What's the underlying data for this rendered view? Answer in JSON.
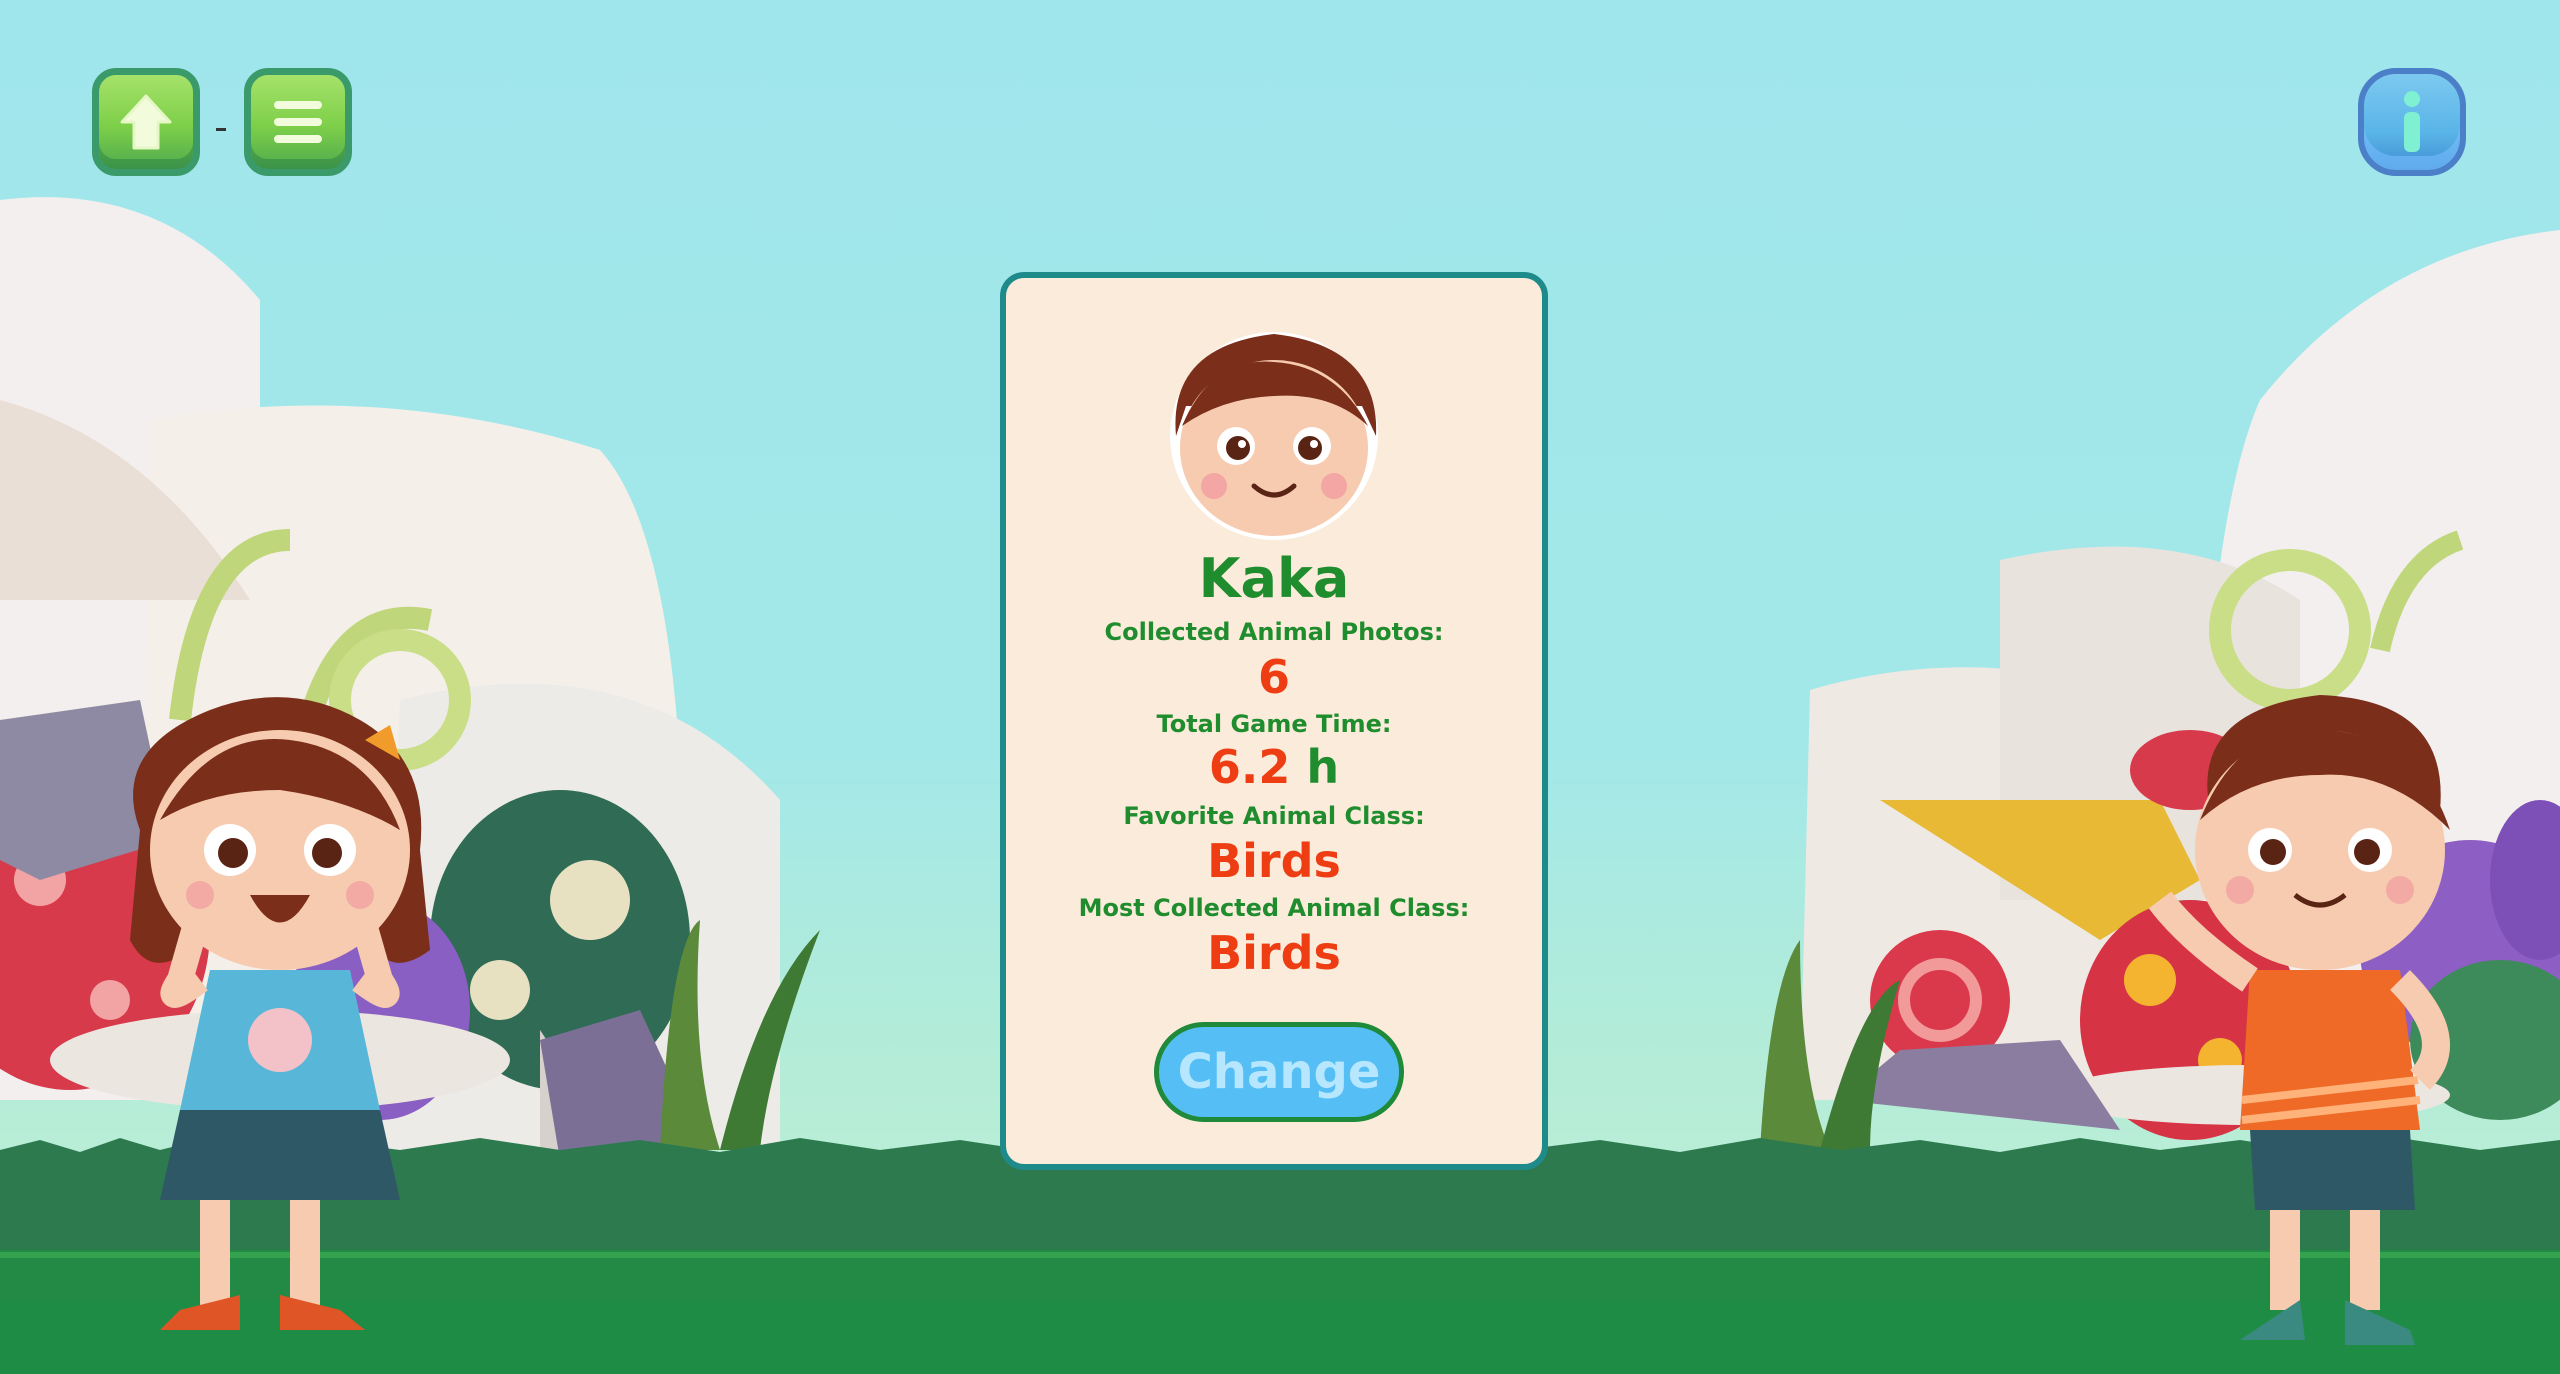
{
  "toolbar": {
    "home_icon": "home-icon",
    "menu_icon": "menu-icon",
    "info_icon": "info-icon"
  },
  "profile": {
    "name": "Kaka",
    "collected_label": "Collected Animal Photos:",
    "collected_value": "6",
    "time_label": "Total Game Time:",
    "time_value": "6.2",
    "time_unit": "h",
    "favorite_label": "Favorite Animal Class:",
    "favorite_value": "Birds",
    "most_label": "Most Collected Animal Class:",
    "most_value": "Birds",
    "change_label": "Change"
  },
  "colors": {
    "accent_green": "#1f8d2e",
    "value_red": "#ee3d12",
    "button_blue": "#55bff5",
    "card_bg": "#faebdb",
    "card_border": "#1f8a8a"
  }
}
